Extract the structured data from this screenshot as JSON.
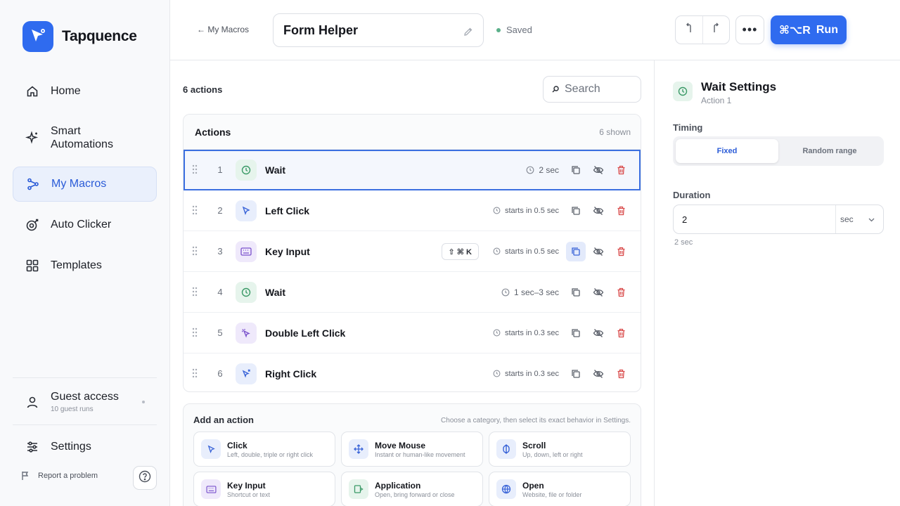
{
  "app": {
    "name": "Tapquence"
  },
  "sidebar": {
    "items": [
      {
        "label": "Home",
        "icon": "home-icon"
      },
      {
        "label": "Smart Automations",
        "icon": "sparkle-icon"
      },
      {
        "label": "My Macros",
        "icon": "macro-path-icon",
        "active": true
      },
      {
        "label": "Auto Clicker",
        "icon": "target-icon"
      },
      {
        "label": "Templates",
        "icon": "grid-icon"
      }
    ],
    "guest": {
      "title": "Guest access",
      "subtitle": "10 guest runs"
    },
    "settings_label": "Settings",
    "report_label": "Report a problem"
  },
  "header": {
    "back_label": "← My Macros",
    "macro_title": "Form Helper",
    "status": "Saved",
    "more_label": "•••",
    "run_shortcut": "⌘⌥R",
    "run_label": "Run"
  },
  "main": {
    "count_label": "6 actions",
    "search_placeholder": "Search",
    "list_title": "Actions",
    "list_shown": "6 shown",
    "actions": [
      {
        "num": "1",
        "name": "Wait",
        "meta": "2 sec",
        "type": "wait"
      },
      {
        "num": "2",
        "name": "Left Click",
        "meta": "starts in 0.5 sec",
        "type": "click"
      },
      {
        "num": "3",
        "name": "Key Input",
        "meta": "starts in 0.5 sec",
        "shortcut": "⇧ ⌘ K",
        "type": "key"
      },
      {
        "num": "4",
        "name": "Wait",
        "meta": "1 sec–3 sec",
        "type": "wait"
      },
      {
        "num": "5",
        "name": "Double Left Click",
        "meta": "starts in 0.3 sec",
        "type": "double"
      },
      {
        "num": "6",
        "name": "Right Click",
        "meta": "starts in 0.3 sec",
        "type": "right"
      }
    ],
    "add": {
      "title": "Add an action",
      "subtitle": "Choose a category, then select its exact behavior in Settings.",
      "categories": [
        {
          "title": "Click",
          "desc": "Left, double, triple or right click"
        },
        {
          "title": "Move Mouse",
          "desc": "Instant or human-like movement"
        },
        {
          "title": "Scroll",
          "desc": "Up, down, left or right"
        },
        {
          "title": "Key Input",
          "desc": "Shortcut or text"
        },
        {
          "title": "Application",
          "desc": "Open, bring forward or close"
        },
        {
          "title": "Open",
          "desc": "Website, file or folder"
        }
      ]
    }
  },
  "panel": {
    "title": "Wait Settings",
    "subtitle": "Action 1",
    "timing_label": "Timing",
    "timing_options": [
      "Fixed",
      "Random range"
    ],
    "duration_label": "Duration",
    "duration_value": "2",
    "duration_unit": "sec",
    "hint": "2 sec"
  },
  "colors": {
    "accent": "#2f6bef",
    "danger": "#d94a4a",
    "saved": "#5bb08a"
  }
}
